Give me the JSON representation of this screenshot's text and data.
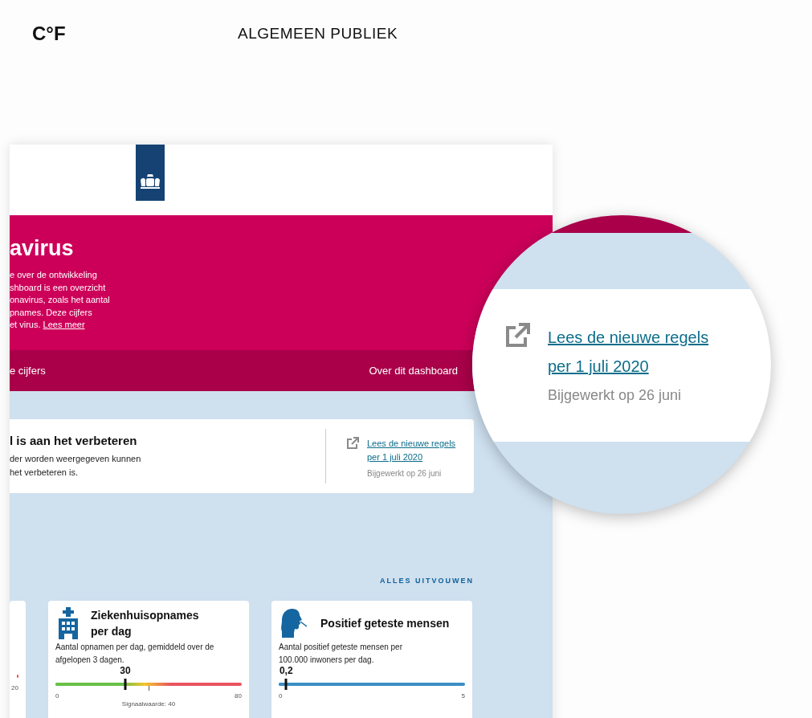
{
  "brand": {
    "logo": "C°F",
    "audience": "ALGEMEEN PUBLIEK"
  },
  "hero": {
    "title": "avirus",
    "lines": [
      "e over de ontwikkeling",
      "shboard is een overzicht",
      "onavirus, zoals het aantal",
      "pnames. Deze cijfers",
      "et virus."
    ],
    "link": "Lees meer"
  },
  "nav": [
    {
      "label": "e cijfers"
    },
    {
      "label": "Over dit dashboard"
    }
  ],
  "notice": {
    "title": "l is aan het verbeteren",
    "lines": [
      "der worden weergegeven kunnen",
      "het verbeteren is."
    ],
    "link": "Lees de nieuwe regels per 1 juli 2020",
    "updated": "Bijgewerkt op 26 juni"
  },
  "expand_all": "ALLES UITVOUWEN",
  "cards": [
    {
      "kind": "partial",
      "scale_max": "20"
    },
    {
      "kind": "hospital",
      "title": "Ziekenhuisopnames per dag",
      "description": "Aantal opnamen per dag, gemiddeld over de afgelopen 3 dagen.",
      "value": "30",
      "level": 0.375,
      "scale_min": "0",
      "scale_max": "80",
      "signal": "Signaalwaarde: 40"
    },
    {
      "kind": "tested",
      "title": "Positief geteste mensen",
      "description": "Aantal positief geteste mensen per 100.000 inwoners per dag.",
      "value": "0,2",
      "level": 0.04,
      "scale_min": "0",
      "scale_max": "5"
    }
  ],
  "magnifier": {
    "link": "Lees de nieuwe regels per 1 juli 2020",
    "updated": "Bijgewerkt op 26 juni"
  }
}
